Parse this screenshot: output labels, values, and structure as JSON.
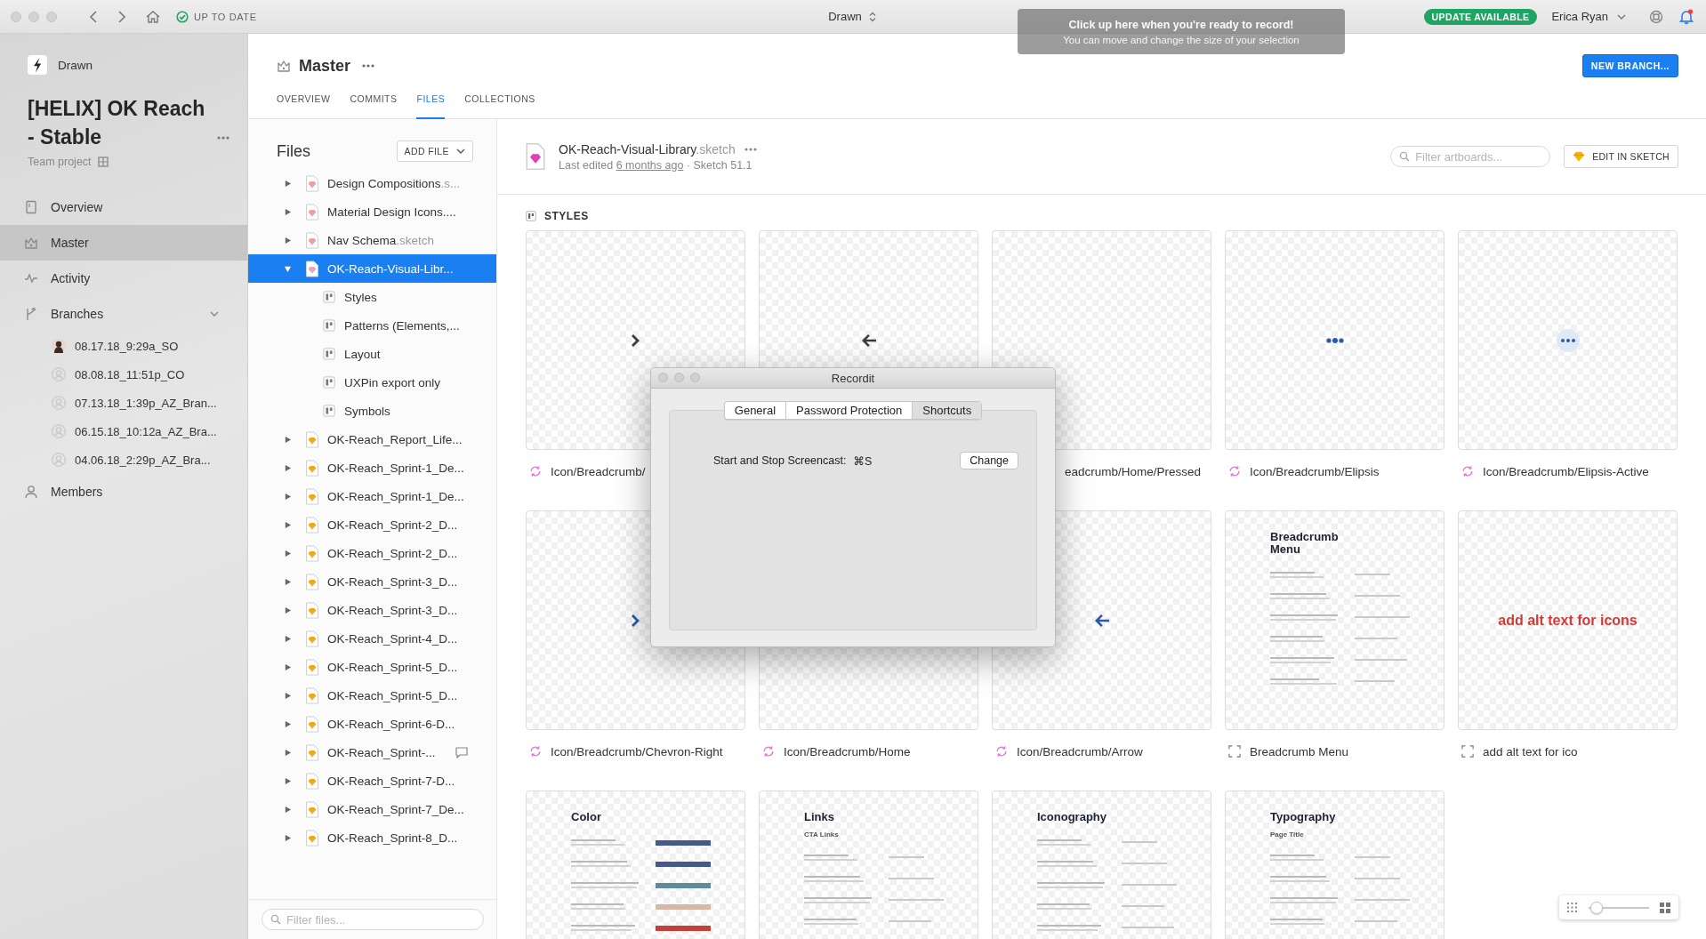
{
  "titlebar": {
    "sync_status": "UP TO DATE",
    "app_title": "Drawn",
    "tooltip": {
      "title": "Click up here when you're ready to record!",
      "text": "You can move and change the size of your selection"
    },
    "update_badge": "UPDATE AVAILABLE",
    "user": "Erica Ryan",
    "notifications": true
  },
  "sidebar": {
    "app_name": "Drawn",
    "project_title": "[HELIX] OK Reach - Stable",
    "project_type": "Team project",
    "items": [
      {
        "label": "Overview",
        "selected": false
      },
      {
        "label": "Master",
        "selected": true
      },
      {
        "label": "Activity",
        "selected": false
      },
      {
        "label": "Branches",
        "selected": false,
        "expanded": true,
        "children": [
          {
            "label": "08.17.18_9:29a_SO",
            "kind": "photo"
          },
          {
            "label": "08.08.18_11:51p_CO",
            "kind": "placeholder"
          },
          {
            "label": "07.13.18_1:39p_AZ_Bran...",
            "kind": "placeholder"
          },
          {
            "label": "06.15.18_10:12a_AZ_Bra...",
            "kind": "placeholder"
          },
          {
            "label": "04.06.18_2:29p_AZ_Bra...",
            "kind": "placeholder"
          }
        ]
      },
      {
        "label": "Members",
        "selected": false
      }
    ]
  },
  "header": {
    "branch": "Master",
    "tabs": [
      {
        "label": "OVERVIEW",
        "selected": false
      },
      {
        "label": "COMMITS",
        "selected": false
      },
      {
        "label": "FILES",
        "selected": true
      },
      {
        "label": "COLLECTIONS",
        "selected": false
      }
    ],
    "new_branch_button": "NEW BRANCH..."
  },
  "files": {
    "title": "Files",
    "add_button": "ADD FILE",
    "tree": [
      {
        "name": "Design Compositions",
        "ext": ".s...",
        "color": "#e8a2a2",
        "expanded": false,
        "selected": false,
        "comments": false
      },
      {
        "name": "Material Design Icons....",
        "color": "#e8a2a2",
        "expanded": false,
        "selected": false,
        "comments": false
      },
      {
        "name": "Nav Schema",
        "ext": ".sketch",
        "color": "#e8a2a2",
        "expanded": false,
        "selected": false,
        "comments": false
      },
      {
        "name": "OK-Reach-Visual-Libr...",
        "color": "#e6a6c0",
        "expanded": true,
        "selected": true,
        "comments": false,
        "children": [
          {
            "name": "Styles",
            "selected": false
          },
          {
            "name": "Patterns (Elements,...",
            "selected": false
          },
          {
            "name": "Layout",
            "selected": false
          },
          {
            "name": "UXPin export only",
            "selected": false
          },
          {
            "name": "Symbols",
            "selected": false
          }
        ]
      },
      {
        "name": "OK-Reach_Report_Life...",
        "color": "#f5a623",
        "expanded": false,
        "selected": false,
        "comments": false
      },
      {
        "name": "OK-Reach_Sprint-1_De...",
        "color": "#f5a623",
        "expanded": false,
        "selected": false,
        "comments": false
      },
      {
        "name": "OK-Reach_Sprint-1_De...",
        "color": "#f5a623",
        "expanded": false,
        "selected": false,
        "comments": false
      },
      {
        "name": "OK-Reach_Sprint-2_D...",
        "color": "#f5a623",
        "expanded": false,
        "selected": false,
        "comments": false
      },
      {
        "name": "OK-Reach_Sprint-2_D...",
        "color": "#f5a623",
        "expanded": false,
        "selected": false,
        "comments": false
      },
      {
        "name": "OK-Reach_Sprint-3_D...",
        "color": "#f5a623",
        "expanded": false,
        "selected": false,
        "comments": false
      },
      {
        "name": "OK-Reach_Sprint-3_D...",
        "color": "#f5a623",
        "expanded": false,
        "selected": false,
        "comments": false
      },
      {
        "name": "OK-Reach_Sprint-4_D...",
        "color": "#f5a623",
        "expanded": false,
        "selected": false,
        "comments": false
      },
      {
        "name": "OK-Reach_Sprint-5_D...",
        "color": "#f5a623",
        "expanded": false,
        "selected": false,
        "comments": false
      },
      {
        "name": "OK-Reach_Sprint-5_D...",
        "color": "#f5a623",
        "expanded": false,
        "selected": false,
        "comments": false
      },
      {
        "name": "OK-Reach_Sprint-6-D...",
        "color": "#f5a623",
        "expanded": false,
        "selected": false,
        "comments": false
      },
      {
        "name": "OK-Reach_Sprint-...",
        "color": "#f5a623",
        "expanded": false,
        "selected": false,
        "comments": true
      },
      {
        "name": "OK-Reach_Sprint-7-D...",
        "color": "#f5a623",
        "expanded": false,
        "selected": false,
        "comments": false
      },
      {
        "name": "OK-Reach_Sprint-7_De...",
        "color": "#f5a623",
        "expanded": false,
        "selected": false,
        "comments": false
      },
      {
        "name": "OK-Reach_Sprint-8_D...",
        "color": "#f5a623",
        "expanded": false,
        "selected": false,
        "comments": false
      }
    ],
    "filter_placeholder": "Filter files..."
  },
  "document": {
    "name": "OK-Reach-Visual-Library",
    "ext": ".sketch",
    "edited_prefix": "Last edited",
    "edited_link": "6 months ago",
    "version": "· Sketch 51.1",
    "filter_placeholder": "Filter artboards...",
    "edit_button": "EDIT IN SKETCH",
    "section": "STYLES",
    "artboards": [
      {
        "label": "Icon/Breadcrumb/",
        "kind": "chevron",
        "color": "#3c3c3c"
      },
      {
        "kind": "arrow",
        "color": "#3c3c3c"
      },
      {
        "label": "eadcrumb/Home/Pressed",
        "kind": "covered"
      },
      {
        "label": "Icon/Breadcrumb/Elipsis",
        "kind": "dots",
        "color": "#2c5aa8"
      },
      {
        "label": "Icon/Breadcrumb/Elipsis-Active",
        "kind": "highlighted",
        "color": "#2c5aa8"
      },
      {
        "label": "Icon/Breadcrumb/Chevron-Right",
        "kind": "chevron",
        "color": "#2c5aa8"
      },
      {
        "label": "Icon/Breadcrumb/Home",
        "kind": "blank"
      },
      {
        "label": "Icon/Breadcrumb/Arrow",
        "kind": "arrow",
        "color": "#2c5aa8"
      },
      {
        "label": "Breadcrumb Menu",
        "kind": "document",
        "heading": "Breadcrumb Menu"
      },
      {
        "label": "add alt text for ico",
        "kind": "note",
        "note": "add alt text for icons"
      },
      {
        "kind": "palette",
        "heading": "Color"
      },
      {
        "kind": "document",
        "heading": "Links",
        "subheading": "CTA Links"
      },
      {
        "kind": "document",
        "heading": "Iconography"
      },
      {
        "kind": "document",
        "heading": "Typography",
        "subheading": "Page Title"
      }
    ]
  },
  "recordit": {
    "title": "Recordit",
    "tabs": [
      {
        "label": "General",
        "selected": false
      },
      {
        "label": "Password Protection",
        "selected": false
      },
      {
        "label": "Shortcuts",
        "selected": true
      }
    ],
    "shortcut_label": "Start and Stop Screencast:",
    "shortcut": "⌘S",
    "change_button": "Change"
  },
  "zoom": {
    "level": 0.05
  }
}
